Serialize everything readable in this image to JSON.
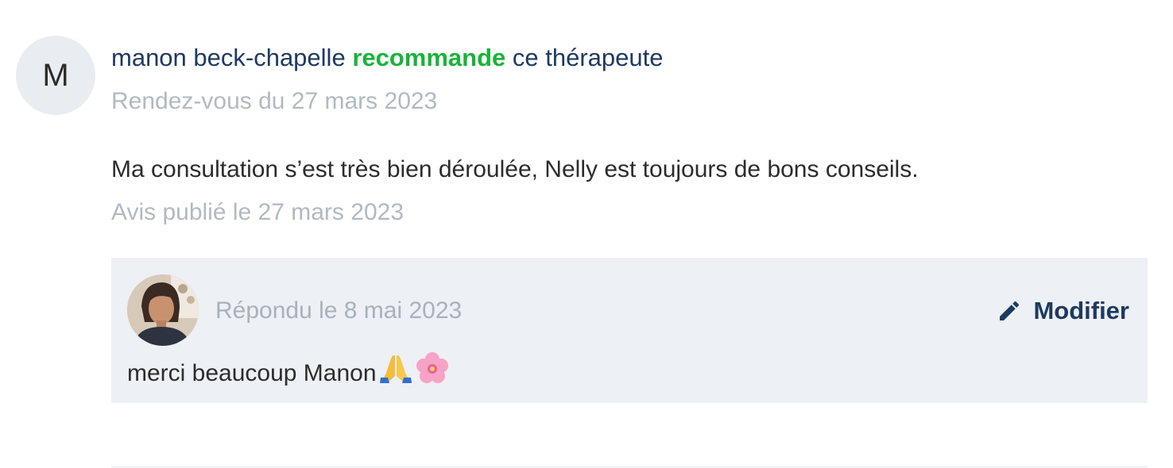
{
  "review": {
    "avatar_initial": "M",
    "author": "manon beck-chapelle",
    "recommend_word": "recommande",
    "recommend_suffix": "ce thérapeute",
    "appointment_date": "Rendez-vous du 27 mars 2023",
    "text": "Ma consultation s’est très bien déroulée, Nelly est toujours de bons conseils.",
    "published": "Avis publié le 27 mars 2023"
  },
  "reply": {
    "date": "Répondu le 8 mai 2023",
    "edit_label": "Modifier",
    "text": "merci beaucoup Manon",
    "icons": [
      "pencil-icon",
      "praying-hands-emoji",
      "cherry-blossom-emoji"
    ]
  },
  "colors": {
    "recommend": "#19b33a",
    "primary_text": "#1f3a60",
    "muted_text": "#b2b9c1",
    "reply_background": "#edf0f4"
  }
}
